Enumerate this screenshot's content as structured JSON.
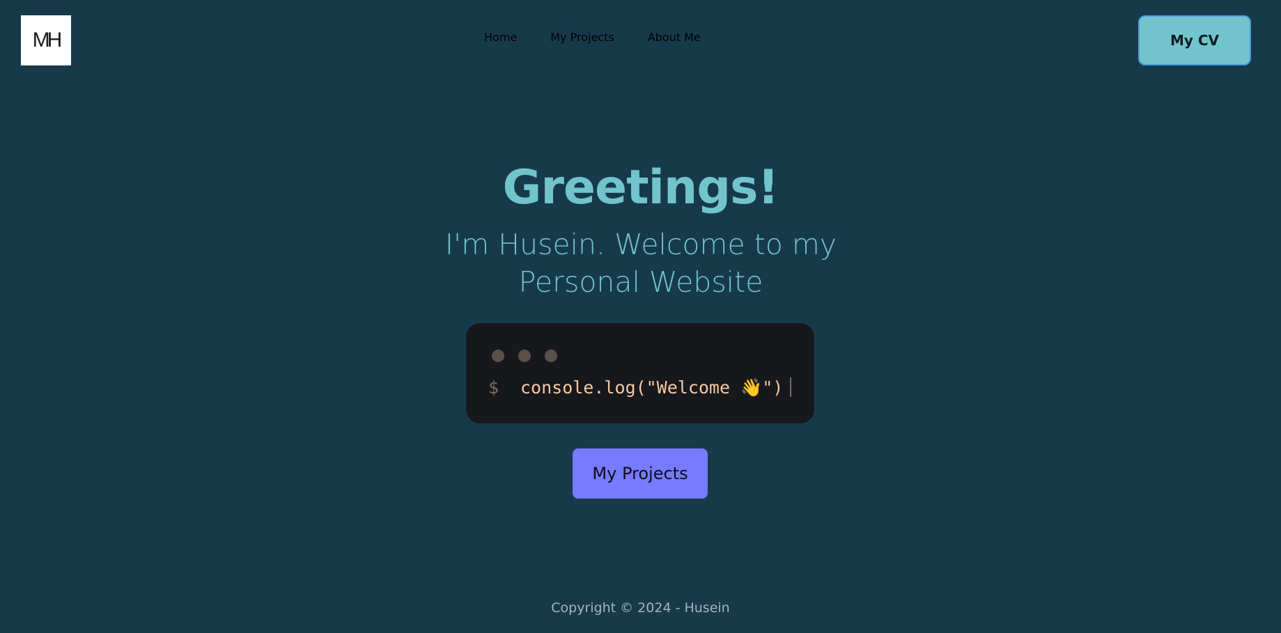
{
  "logo": {
    "text": "MH"
  },
  "nav": {
    "items": [
      {
        "label": "Home"
      },
      {
        "label": "My Projects"
      },
      {
        "label": "About Me"
      }
    ],
    "cv_label": "My CV"
  },
  "hero": {
    "title": "Greetings!",
    "subtitle": "I'm Husein. Welcome to my Personal Website"
  },
  "terminal": {
    "prompt": "$",
    "code": "console.log(\"Welcome 👋\")"
  },
  "cta": {
    "label": "My Projects"
  },
  "footer": {
    "copyright": "Copyright © 2024 - Husein"
  },
  "colors": {
    "background": "#173a4b",
    "accent": "#72c4cc",
    "nav_text": "#a7b3be",
    "terminal_bg": "#17181c",
    "code_text": "#f6c9a0",
    "cta_bg": "#767bff"
  }
}
